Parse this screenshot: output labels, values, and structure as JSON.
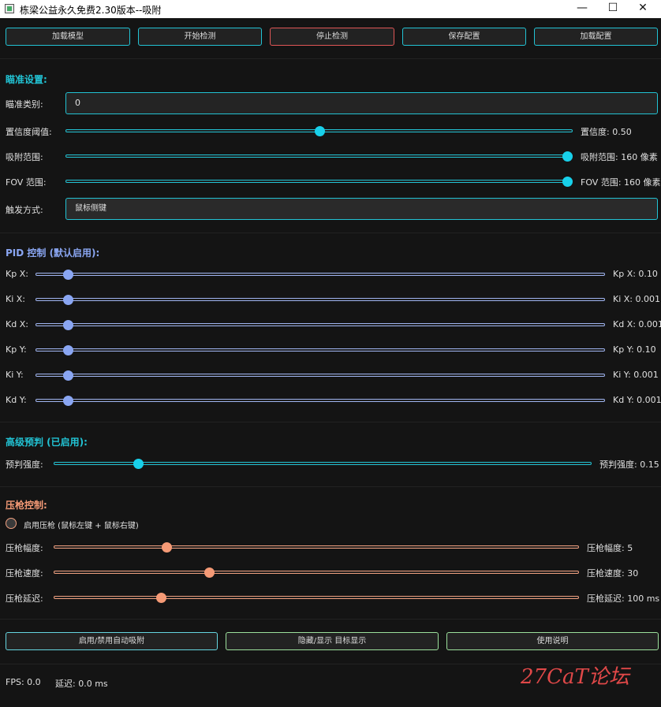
{
  "window": {
    "title": "栋梁公益永久免费2.30版本--吸附",
    "minimize": "—",
    "maximize": "☐",
    "close": "✕"
  },
  "toolbar": {
    "load_model": "加载模型",
    "start": "开始检测",
    "stop": "停止检测",
    "save_config": "保存配置",
    "load_config": "加载配置"
  },
  "aim": {
    "section": "瞄准设置:",
    "category_label": "瞄准类别:",
    "category_value": "0",
    "confidence_label": "置信度阈值:",
    "confidence_value": "置信度: 0.50",
    "confidence_level": 0.5,
    "snap_label": "吸附范围:",
    "snap_value": "吸附范围: 160 像素",
    "snap_level": 1.0,
    "fov_label": "FOV 范围:",
    "fov_value": "FOV 范围: 160 像素",
    "fov_level": 1.0,
    "trigger_label": "触发方式:",
    "trigger_value": "鼠标侧键"
  },
  "pid": {
    "section": "PID 控制 (默认启用):",
    "rows": [
      {
        "label": "Kp X:",
        "value": "Kp X: 0.10"
      },
      {
        "label": "Ki X:",
        "value": "Ki X: 0.001"
      },
      {
        "label": "Kd X:",
        "value": "Kd X: 0.001"
      },
      {
        "label": "Kp Y:",
        "value": "Kp Y: 0.10"
      },
      {
        "label": "Ki Y:",
        "value": "Ki Y: 0.001"
      },
      {
        "label": "Kd Y:",
        "value": "Kd Y: 0.001"
      }
    ]
  },
  "predict": {
    "section": "高级预判 (已启用):",
    "label": "预判强度:",
    "value": "预判强度: 0.15"
  },
  "recoil": {
    "section": "压枪控制:",
    "checkbox": "启用压枪 (鼠标左键 + 鼠标右键)",
    "rows": [
      {
        "label": "压枪幅度:",
        "value": "压枪幅度: 5"
      },
      {
        "label": "压枪速度:",
        "value": "压枪速度: 30"
      },
      {
        "label": "压枪延迟:",
        "value": "压枪延迟: 100 ms"
      }
    ]
  },
  "bottom": {
    "toggle": "启用/禁用自动吸附",
    "hide_show": "隐藏/显示 目标显示",
    "help": "使用说明"
  },
  "status": {
    "fps": "FPS: 0.0",
    "latency": "延迟: 0.0 ms"
  },
  "watermark": "27CaT论坛",
  "colors": {
    "cyan": "#22c3d4",
    "blue": "#8aa6f2",
    "orange": "#f59a76",
    "red": "#e05656",
    "green": "#9ce09c"
  }
}
